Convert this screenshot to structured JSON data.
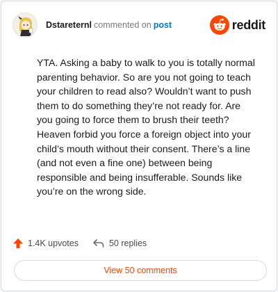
{
  "comment": {
    "author": "Dstareternl",
    "action_text": "commented on",
    "target_link": "post",
    "body": "YTA. Asking a baby to walk to you is totally normal parenting behavior. So are you not going to teach your children to read also? Wouldn’t want to push them to do something they’re not ready for. Are you going to force them to brush their teeth? Heaven forbid you force a foreign object into your child’s mouth without their consent. There’s a line (and not even a fine one) between being responsible and being insufferable. Sounds like you’re on the wrong side."
  },
  "brand": {
    "wordmark": "reddit",
    "logo_icon": "reddit-snoo-icon",
    "accent_color": "#ff4500"
  },
  "actions": {
    "upvotes": "1.4K upvotes",
    "upvote_icon": "upvote-arrow-icon",
    "replies": "50 replies",
    "reply_icon": "reply-arrow-icon"
  },
  "footer": {
    "view_comments": "View 50 comments"
  }
}
